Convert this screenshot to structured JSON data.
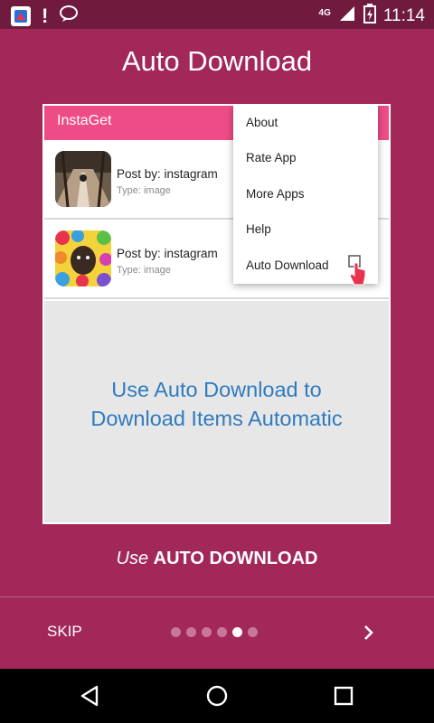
{
  "status_bar": {
    "network": "4G",
    "time": "11:14",
    "icons": [
      "app-notification-icon",
      "alert-icon",
      "chat-icon",
      "signal-icon",
      "battery-icon"
    ]
  },
  "title": "Auto Download",
  "preview": {
    "app_name": "InstaGet",
    "items": [
      {
        "title": "Post by: instagram",
        "subtitle": "Type: image",
        "thumb": "bridge-photo"
      },
      {
        "title": "Post by: instagram",
        "subtitle": "Type: image",
        "thumb": "dog-candy-photo"
      }
    ],
    "menu": [
      "About",
      "Rate App",
      "More Apps",
      "Help",
      "Auto Download"
    ],
    "promo_line1": "Use Auto Download to",
    "promo_line2": "Download Items Automatic"
  },
  "caption": {
    "prefix": "Use",
    "emphasis": "AUTO DOWNLOAD"
  },
  "footer": {
    "skip_label": "SKIP",
    "dots_total": 6,
    "dots_active_index": 4,
    "next_icon": "chevron-right-icon"
  },
  "colors": {
    "background": "#a2285a",
    "status_bar": "#701a3e",
    "accent_pink": "#ee4c86",
    "promo_blue": "#2f7bbf"
  }
}
